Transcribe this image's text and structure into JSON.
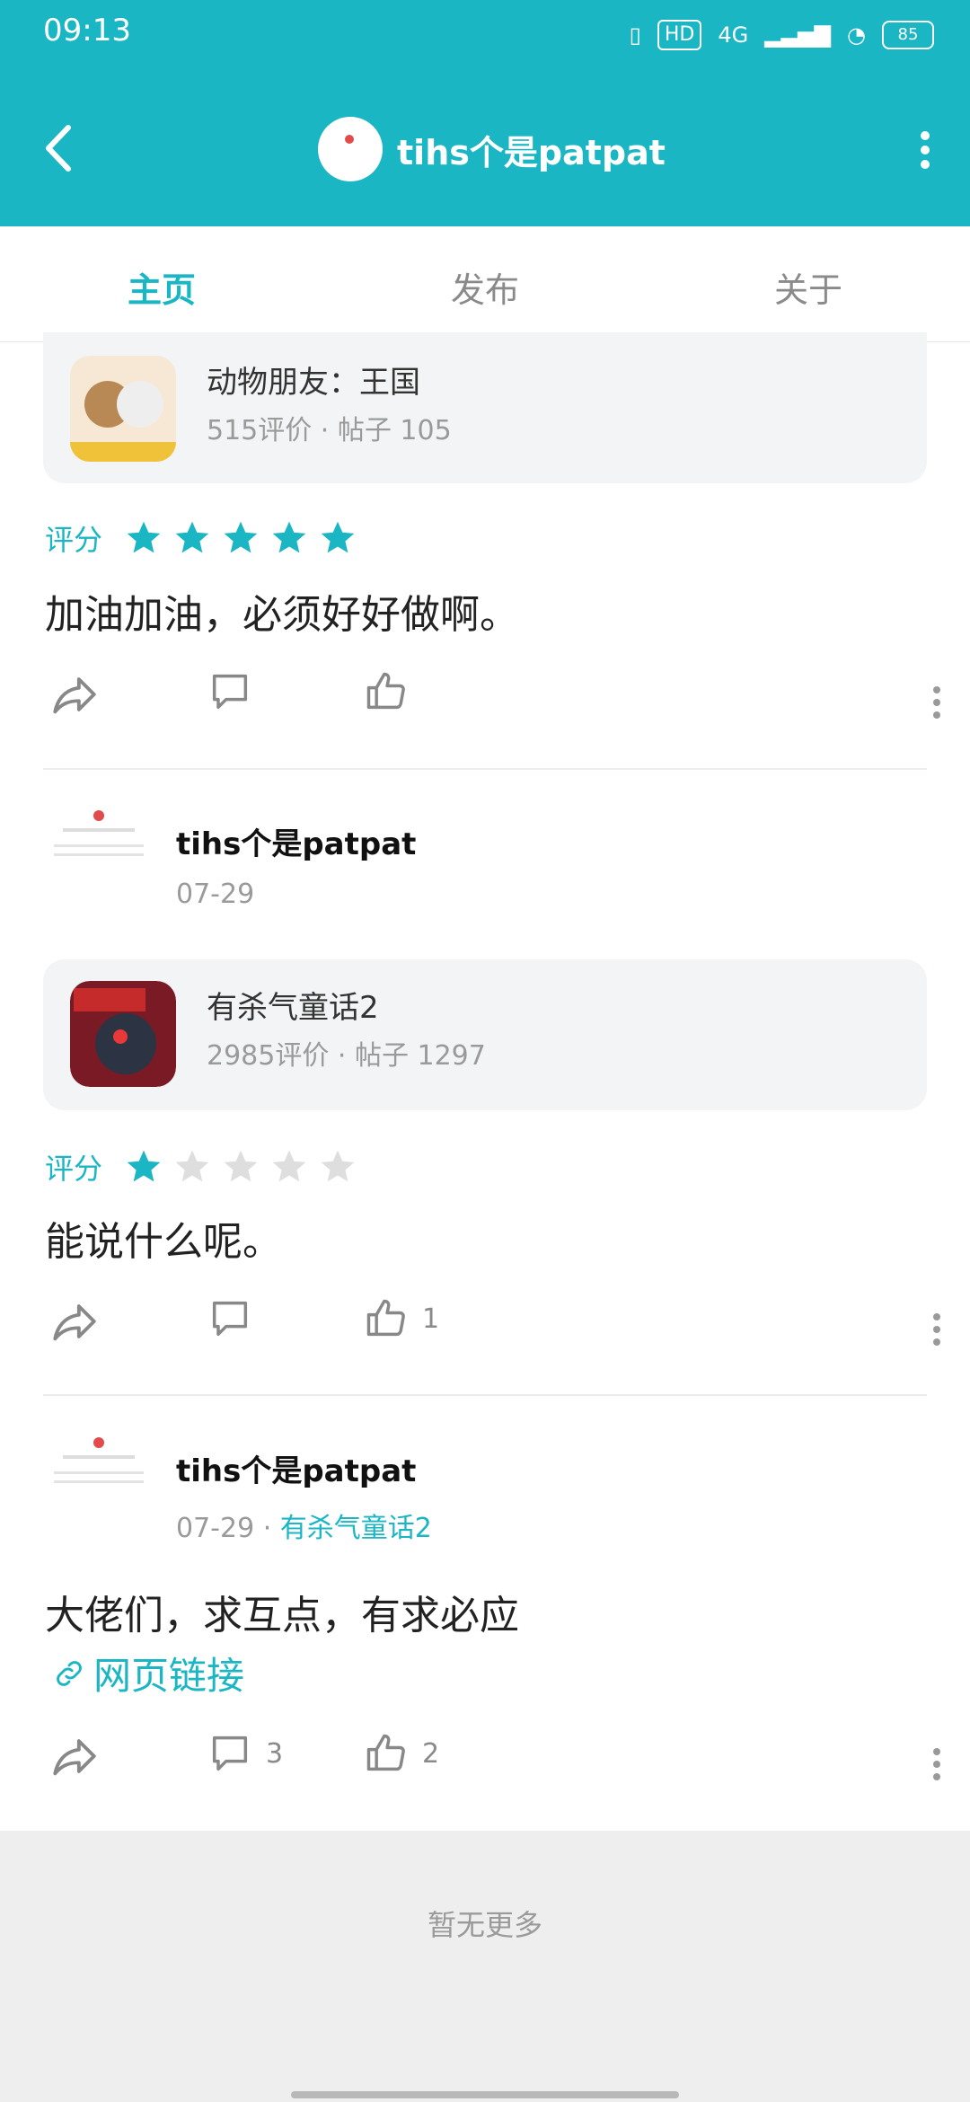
{
  "status_bar": {
    "time": "09:13",
    "network": "4G",
    "hd": "HD",
    "battery": "85"
  },
  "header": {
    "title": "tihs个是patpat"
  },
  "tabs": [
    {
      "label": "主页",
      "active": true
    },
    {
      "label": "发布",
      "active": false
    },
    {
      "label": "关于",
      "active": false
    }
  ],
  "posts": [
    {
      "game": {
        "name": "动物朋友：王国",
        "stats": "515评价 · 帖子 105"
      },
      "rating": {
        "label": "评分",
        "stars": 5,
        "max": 5
      },
      "text": "加油加油，必须好好做啊。",
      "actions": {
        "comments": "",
        "likes": ""
      }
    },
    {
      "user": {
        "name": "tihs个是patpat",
        "date": "07-29"
      },
      "game": {
        "name": "有杀气童话2",
        "stats": "2985评价 · 帖子 1297"
      },
      "rating": {
        "label": "评分",
        "stars": 1,
        "max": 5
      },
      "text": "能说什么呢。",
      "actions": {
        "comments": "",
        "likes": "1"
      }
    },
    {
      "user": {
        "name": "tihs个是patpat",
        "date": "07-29",
        "sep": " · ",
        "game": "有杀气童话2"
      },
      "text": "大佬们，求互点，有求必应",
      "link": "网页链接",
      "actions": {
        "comments": "3",
        "likes": "2"
      }
    }
  ],
  "footer": {
    "no_more": "暂无更多"
  },
  "colors": {
    "accent": "#1bb6c4",
    "star_off": "#dedede"
  }
}
